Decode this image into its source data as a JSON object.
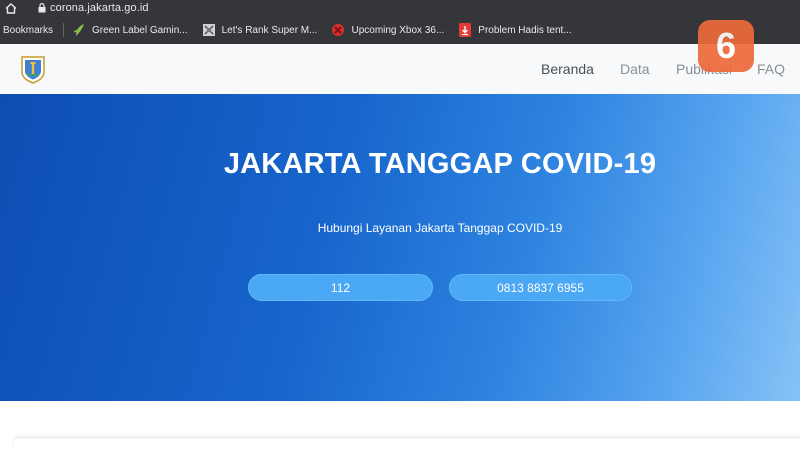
{
  "browser": {
    "url": "corona.jakarta.go.id"
  },
  "bookmarks": {
    "label": "Bookmarks",
    "items": [
      {
        "label": "Green Label Gamin...",
        "icon": "leaf-icon"
      },
      {
        "label": "Let's Rank Super M...",
        "icon": "game-icon"
      },
      {
        "label": "Upcoming Xbox 36...",
        "icon": "xbox-icon"
      },
      {
        "label": "Problem Hadis tent...",
        "icon": "download-icon"
      }
    ]
  },
  "header": {
    "nav": [
      {
        "label": "Beranda",
        "active": true
      },
      {
        "label": "Data",
        "active": false
      },
      {
        "label": "Publikasi",
        "active": false
      },
      {
        "label": "FAQ",
        "active": false
      }
    ]
  },
  "watermark": {
    "text": "6"
  },
  "hero": {
    "title": "JAKARTA TANGGAP COVID-19",
    "subtitle": "Hubungi Layanan Jakarta Tanggap COVID-19",
    "buttons": [
      {
        "label": "112"
      },
      {
        "label": "0813 8837 6955"
      }
    ]
  },
  "colors": {
    "hero_gradient_start": "#0d4db2",
    "hero_gradient_end": "#86c2f6",
    "button": "#4aa8f4",
    "watermark": "#ee6a3b"
  }
}
